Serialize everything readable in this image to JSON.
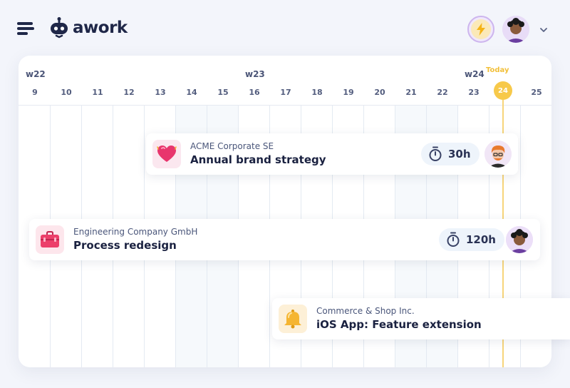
{
  "app": {
    "logo_text": "awork"
  },
  "timeline": {
    "weeks": [
      "w22",
      "w23",
      "w24"
    ],
    "days": [
      "9",
      "10",
      "11",
      "12",
      "13",
      "14",
      "15",
      "16",
      "17",
      "18",
      "19",
      "20",
      "21",
      "22",
      "23",
      "24",
      "25"
    ],
    "today_label": "Today",
    "today_day": "24"
  },
  "projects": [
    {
      "company": "ACME Corporate SE",
      "title": "Annual brand strategy",
      "hours": "30h",
      "icon": "heart-icon"
    },
    {
      "company": "Engineering Company GmbH",
      "title": "Process redesign",
      "hours": "120h",
      "icon": "toolbox-icon"
    },
    {
      "company": "Commerce & Shop Inc.",
      "title": "iOS App: Feature extension",
      "icon": "bell-icon"
    }
  ],
  "colors": {
    "accent": "#f7c94a",
    "text_dark": "#1f2748",
    "grid": "#e4eaf2"
  }
}
